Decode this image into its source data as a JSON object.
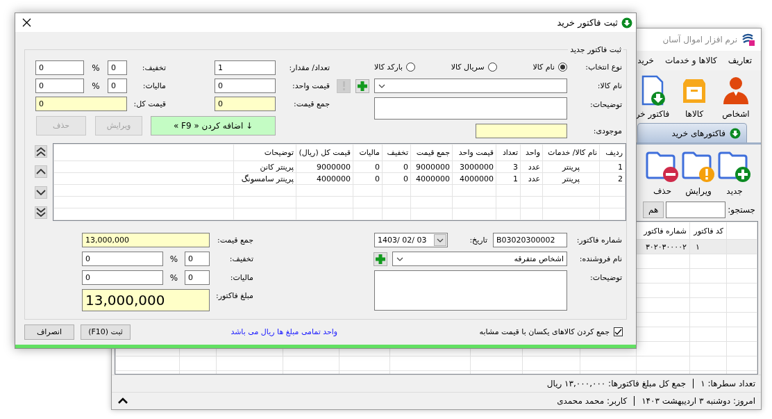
{
  "main_window": {
    "title": "نرم افزار اموال آسان",
    "menu": [
      {
        "label": "تعاریف"
      },
      {
        "label": "کالاها و خدمات"
      },
      {
        "label": "خرید"
      }
    ],
    "toolbar": [
      {
        "label": "اشخاص",
        "kind": "person"
      },
      {
        "label": "کالاها",
        "kind": "box"
      },
      {
        "label": "فاکتور خر",
        "kind": "invoice"
      }
    ],
    "tabs": [
      {
        "label": "فاکتورهای خرید",
        "selected": true
      }
    ],
    "actions": [
      {
        "label": "جدید",
        "kind": "add"
      },
      {
        "label": "ویرایش",
        "kind": "edit"
      },
      {
        "label": "حذف",
        "kind": "delete"
      }
    ],
    "search": {
      "label": "جستجو:",
      "button": "هم"
    },
    "grid": {
      "columns": [
        "کد فاکتور",
        "شماره فاکتور"
      ],
      "rows": [
        {
          "cells": [
            "۱",
            "۳۰۲۰۳۰۰۰۰۲"
          ],
          "selected": true
        }
      ]
    },
    "status_bar": [
      "تعداد سطرها:   ۱",
      "جمع کل مبلغ فاکتورها:  ۱۳,۰۰۰,۰۰۰ ریال"
    ],
    "footer": [
      "امروز: دوشنبه ۳ اردیبهشت ۱۴۰۳",
      "کاربر: محمد محمدی"
    ]
  },
  "dialog": {
    "title": "ثبت فاکتور خرید",
    "group_title": "ثبت فاکتور جدید",
    "selection": {
      "label": "نوع انتخاب:",
      "options": [
        {
          "label": "نام کالا",
          "selected": true
        },
        {
          "label": "سریال کالا",
          "selected": false
        },
        {
          "label": "بارکد کالا",
          "selected": false
        }
      ]
    },
    "item_name": {
      "label": "نام کالا:",
      "add_disabled": false,
      "info_disabled": true
    },
    "item_notes": {
      "label": "توضیحات:"
    },
    "stock": {
      "label": "موجودی:"
    },
    "quantity": {
      "label": "تعداد/ مقدار:",
      "value": "1"
    },
    "unit_price": {
      "label": "قیمت واحد:",
      "value": "0"
    },
    "line_sum": {
      "label": "جمع قیمت:",
      "value": "0"
    },
    "line_discount": {
      "label": "تخفیف:",
      "percent": "0",
      "unit": "%",
      "value": "0"
    },
    "line_tax": {
      "label": "مالیات:",
      "percent": "0",
      "unit": "%",
      "value": "0"
    },
    "line_total": {
      "label": "قیمت کل:",
      "value": "0"
    },
    "line_buttons": [
      {
        "label": "↓ اضافه کردن « F9 »",
        "kind": "add",
        "disabled": false
      },
      {
        "label": "ویرایش",
        "kind": "edit",
        "disabled": true
      },
      {
        "label": "حذف",
        "kind": "delete",
        "disabled": true
      }
    ],
    "table": {
      "columns": [
        "ردیف",
        "نام کالا/ خدمات",
        "واحد",
        "تعداد",
        "قیمت واحد",
        "جمع قیمت",
        "تخفیف",
        "مالیات",
        "قیمت کل (ریال)",
        "توضیحات"
      ],
      "rows": [
        [
          "1",
          "پرینتر",
          "عدد",
          "3",
          "3000000",
          "9000000",
          "0",
          "0",
          "9000000",
          "پرینتر کانن"
        ],
        [
          "2",
          "پرینتر",
          "عدد",
          "1",
          "4000000",
          "4000000",
          "0",
          "0",
          "4000000",
          "پرینتر سامسونگ"
        ]
      ]
    },
    "invoice_number": {
      "label": "شماره فاکتور:",
      "value": "B03020300002"
    },
    "date": {
      "label": "تاریخ:",
      "value": "1403/ 02/ 03"
    },
    "seller": {
      "label": "نام فروشنده:",
      "value": "اشخاص متفرقه"
    },
    "notes": {
      "label": "توضیحات:"
    },
    "sum": {
      "label": "جمع قیمت:",
      "value": "13,000,000"
    },
    "discount": {
      "label": "تخفیف:",
      "percent": "0",
      "unit": "%",
      "value": "0"
    },
    "tax": {
      "label": "مالیات:",
      "percent": "0",
      "unit": "%",
      "value": "0"
    },
    "amount": {
      "label": "مبلغ فاکتور:",
      "value": "13,000,000"
    },
    "merge": {
      "label": "جمع کردن کالاهای یکسان با قیمت مشابه",
      "checked": true
    },
    "unit_note": "واحد تمامی مبلغ ها ریال می باشد",
    "buttons": [
      {
        "label": "ثبت (F10)"
      },
      {
        "label": "انصراف"
      }
    ]
  }
}
